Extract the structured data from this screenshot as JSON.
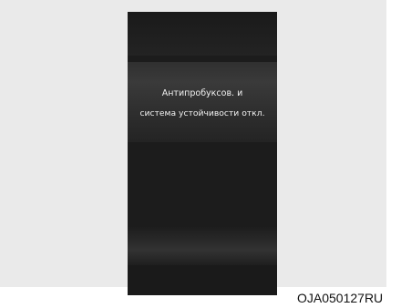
{
  "display": {
    "message_line_1": "Антипробуксов. и",
    "message_line_2": "система устойчивости откл."
  },
  "figure_code": "OJA050127RU",
  "colors": {
    "background": "#eaeaea",
    "screen": "#1c1c1c",
    "text": "#f2f2f2"
  }
}
